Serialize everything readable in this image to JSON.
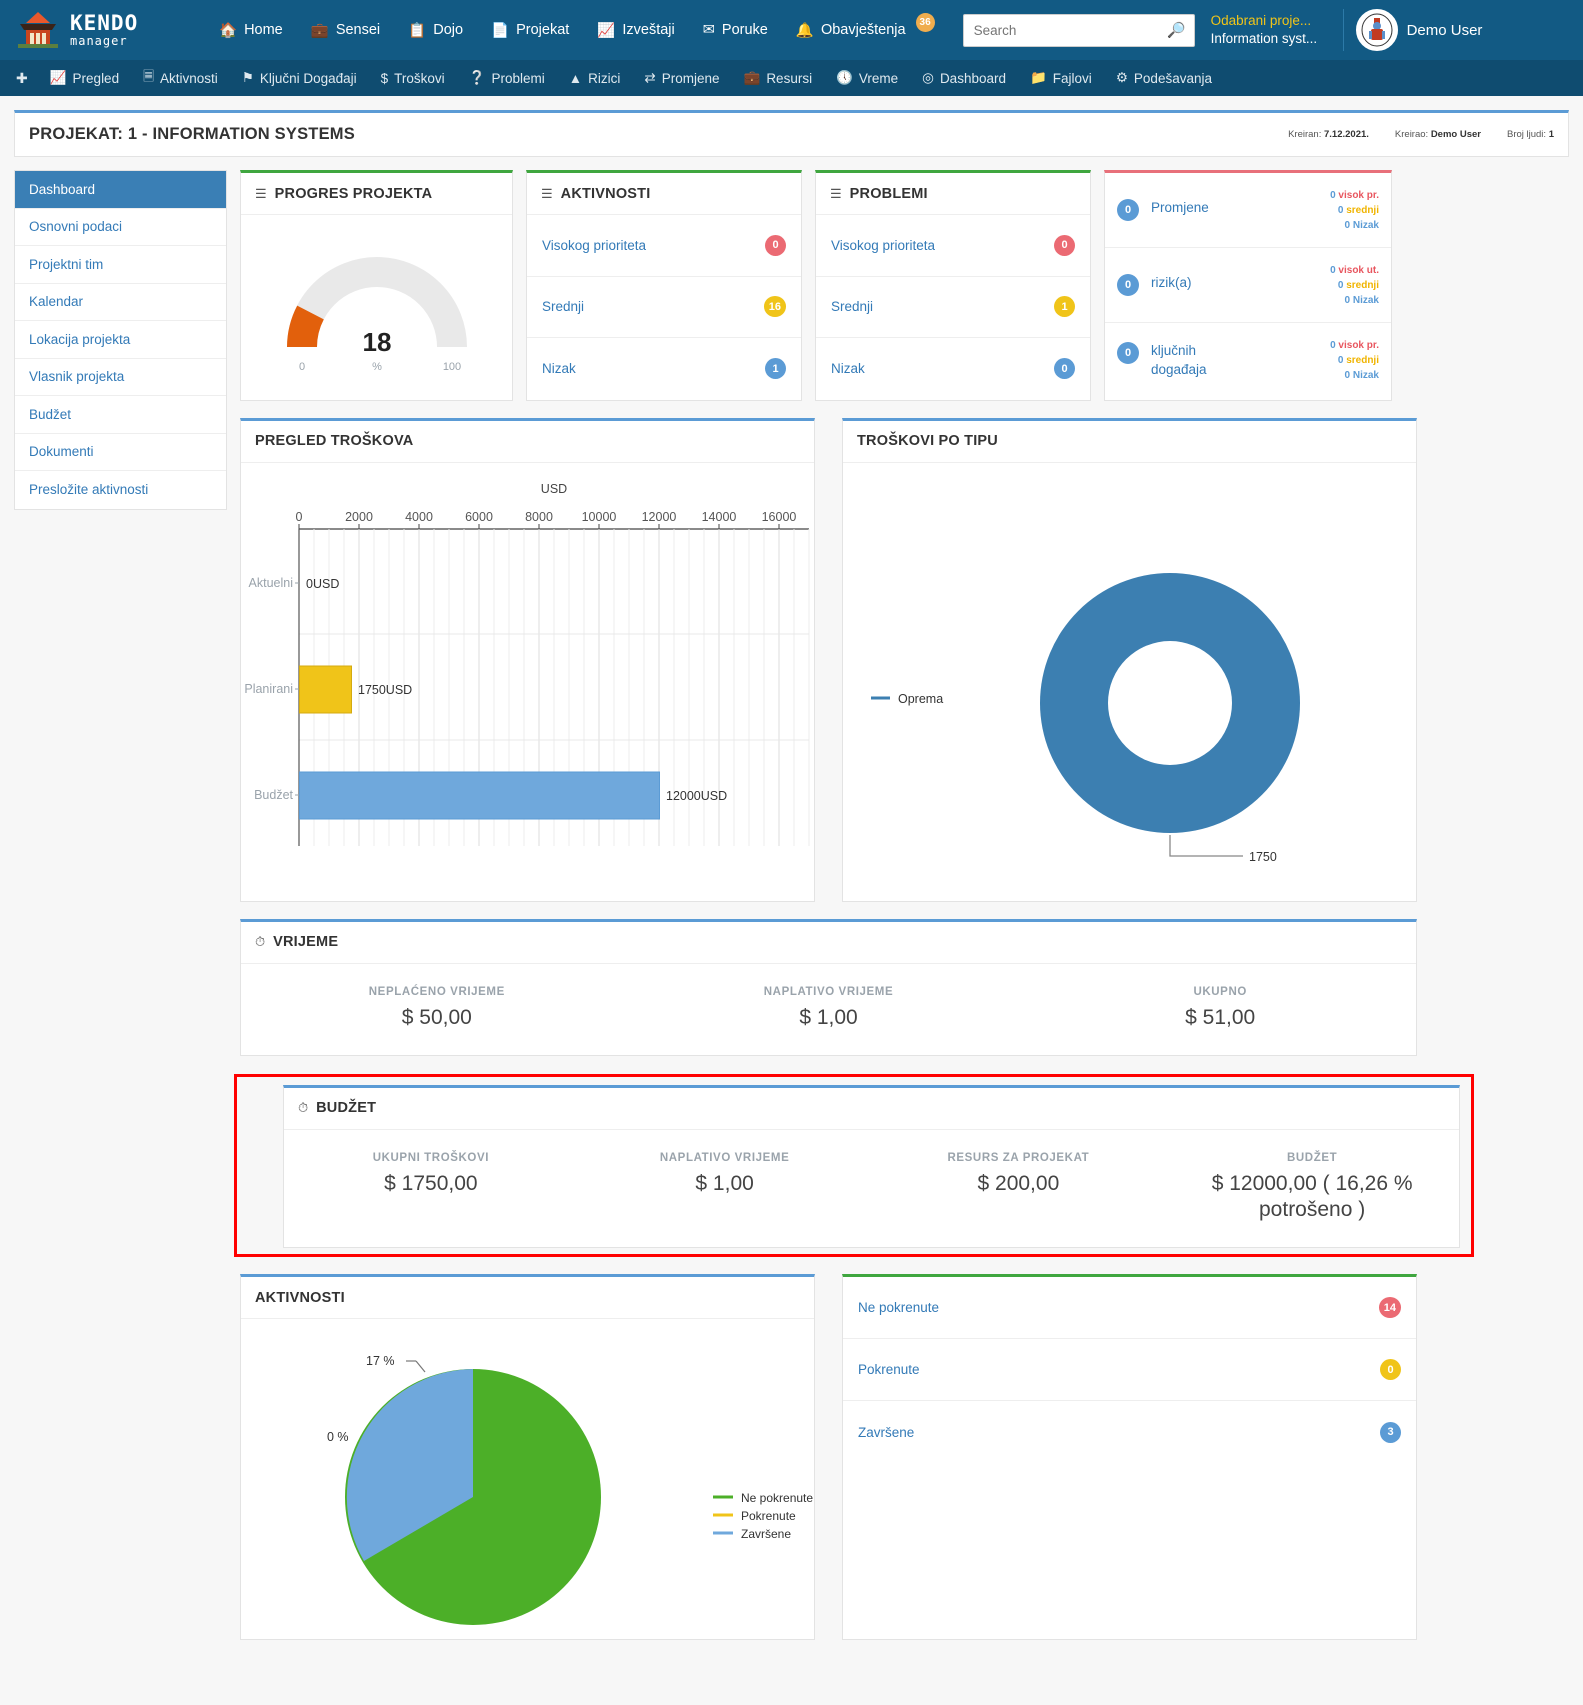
{
  "brand": {
    "name": "KENDO",
    "sub": "manager"
  },
  "topnav": [
    {
      "label": "Home",
      "icon": "home-icon"
    },
    {
      "label": "Sensei",
      "icon": "briefcase-icon"
    },
    {
      "label": "Dojo",
      "icon": "copy-icon"
    },
    {
      "label": "Projekat",
      "icon": "file-icon"
    },
    {
      "label": "Izveštaji",
      "icon": "chart-line-icon"
    },
    {
      "label": "Poruke",
      "icon": "envelope-icon"
    },
    {
      "label": "Obavještenja",
      "icon": "bell-icon",
      "badge": "36"
    }
  ],
  "search": {
    "placeholder": "Search",
    "value": ""
  },
  "project_selector": {
    "line1": "Odabrani proje...",
    "line2": "Information syst..."
  },
  "user": {
    "name": "Demo User"
  },
  "subnav": [
    {
      "label": "Pregled",
      "icon": "chart-line-icon"
    },
    {
      "label": "Aktivnosti",
      "icon": "file-lines-icon"
    },
    {
      "label": "Ključni Događaji",
      "icon": "flag-icon"
    },
    {
      "label": "Troškovi",
      "icon": "dollar-icon"
    },
    {
      "label": "Problemi",
      "icon": "question-circle-icon"
    },
    {
      "label": "Rizici",
      "icon": "warning-triangle-icon"
    },
    {
      "label": "Promjene",
      "icon": "exchange-icon"
    },
    {
      "label": "Resursi",
      "icon": "briefcase-icon"
    },
    {
      "label": "Vreme",
      "icon": "clock-icon"
    },
    {
      "label": "Dashboard",
      "icon": "dashboard-icon"
    },
    {
      "label": "Fajlovi",
      "icon": "folder-icon"
    },
    {
      "label": "Podešavanja",
      "icon": "gear-icon"
    }
  ],
  "page_title": "PROJEKAT: 1 - INFORMATION SYSTEMS",
  "page_meta": {
    "created_label": "Kreiran:",
    "created_value": "7.12.2021.",
    "author_label": "Kreirao:",
    "author_value": "Demo User",
    "people_label": "Broj ljudi:",
    "people_value": "1"
  },
  "sidebar": {
    "items": [
      {
        "label": "Dashboard",
        "active": true
      },
      {
        "label": "Osnovni podaci",
        "active": false
      },
      {
        "label": "Projektni tim",
        "active": false
      },
      {
        "label": "Kalendar",
        "active": false
      },
      {
        "label": "Lokacija projekta",
        "active": false
      },
      {
        "label": "Vlasnik projekta",
        "active": false
      },
      {
        "label": "Budžet",
        "active": false
      },
      {
        "label": "Dokumenti",
        "active": false
      },
      {
        "label": "Presložite aktivnosti",
        "active": false
      }
    ]
  },
  "progress_card": {
    "title": "PROGRES PROJEKTA",
    "value": "18",
    "min": "0",
    "max": "100",
    "unit": "%"
  },
  "aktivnosti_card": {
    "title": "AKTIVNOSTI",
    "rows": [
      {
        "label": "Visokog prioriteta",
        "count": "0",
        "color": "red"
      },
      {
        "label": "Srednji",
        "count": "16",
        "color": "yellow"
      },
      {
        "label": "Nizak",
        "count": "1",
        "color": "blue"
      }
    ]
  },
  "problemi_card": {
    "title": "PROBLEMI",
    "rows": [
      {
        "label": "Visokog prioriteta",
        "count": "0",
        "color": "red"
      },
      {
        "label": "Srednji",
        "count": "1",
        "color": "yellow"
      },
      {
        "label": "Nizak",
        "count": "0",
        "color": "blue"
      }
    ]
  },
  "summary_card": {
    "rows": [
      {
        "count": "0",
        "label": "Promjene",
        "breakdown": [
          {
            "n": "0",
            "text": "visok pr.",
            "level": "high"
          },
          {
            "n": "0",
            "text": "srednji",
            "level": "mid"
          },
          {
            "n": "0",
            "text": "Nizak",
            "level": "low"
          }
        ]
      },
      {
        "count": "0",
        "label": "rizik(a)",
        "breakdown": [
          {
            "n": "0",
            "text": "visok ut.",
            "level": "high"
          },
          {
            "n": "0",
            "text": "srednji",
            "level": "mid"
          },
          {
            "n": "0",
            "text": "Nizak",
            "level": "low"
          }
        ]
      },
      {
        "count": "0",
        "label": "ključnih događaja",
        "breakdown": [
          {
            "n": "0",
            "text": "visok pr.",
            "level": "high"
          },
          {
            "n": "0",
            "text": "srednji",
            "level": "mid"
          },
          {
            "n": "0",
            "text": "Nizak",
            "level": "low"
          }
        ]
      }
    ]
  },
  "vrijeme_card": {
    "title": "VRIJEME",
    "stats": [
      {
        "label": "NEPLAĆENO VRIJEME",
        "value": "$ 50,00"
      },
      {
        "label": "NAPLATIVO VRIJEME",
        "value": "$ 1,00"
      },
      {
        "label": "UKUPNO",
        "value": "$ 51,00"
      }
    ]
  },
  "budzet_card": {
    "title": "BUDŽET",
    "stats": [
      {
        "label": "UKUPNI TROŠKOVI",
        "value": "$ 1750,00"
      },
      {
        "label": "NAPLATIVO VRIJEME",
        "value": "$ 1,00"
      },
      {
        "label": "RESURS ZA PROJEKAT",
        "value": "$ 200,00"
      },
      {
        "label": "BUDŽET",
        "value": "$ 12000,00 ( 16,26 % potrošeno )"
      }
    ]
  },
  "aktivnosti_status": {
    "rows": [
      {
        "label": "Ne pokrenute",
        "count": "14",
        "color": "red"
      },
      {
        "label": "Pokrenute",
        "count": "0",
        "color": "yellow"
      },
      {
        "label": "Završene",
        "count": "3",
        "color": "blue"
      }
    ]
  },
  "chart_data": [
    {
      "type": "bar",
      "orientation": "horizontal",
      "title": "PREGLED TROŠKOVA",
      "xlabel": "USD",
      "ylabel": "",
      "categories": [
        "Aktuelni",
        "Planirani",
        "Budžet"
      ],
      "values": [
        0,
        1750,
        12000
      ],
      "data_labels": [
        "0USD",
        "1750USD",
        "12000USD"
      ],
      "colors": [
        "#3fa63f",
        "#f0c419",
        "#6fa8dc"
      ],
      "xticks": [
        0,
        2000,
        4000,
        6000,
        8000,
        10000,
        12000,
        14000,
        16000
      ],
      "xlim": [
        0,
        17000
      ],
      "grid": true
    },
    {
      "type": "pie",
      "variant": "donut",
      "title": "TROŠKOVI PO TIPU",
      "labels": [
        "Oprema"
      ],
      "values": [
        1750
      ],
      "data_labels": [
        "1750"
      ],
      "colors": [
        "#3c7fb1"
      ],
      "legend": [
        "Oprema"
      ],
      "legend_position": "left"
    },
    {
      "type": "pie",
      "title": "AKTIVNOSTI",
      "labels": [
        "Ne pokrenute",
        "Pokrenute",
        "Završene"
      ],
      "values": [
        83,
        0,
        17
      ],
      "data_labels": [
        "0 %",
        "17 %"
      ],
      "colors": [
        "#4caf28",
        "#f0c419",
        "#6fa8dc"
      ],
      "legend": [
        "Ne pokrenute",
        "Pokrenute",
        "Završene"
      ],
      "legend_position": "right"
    }
  ]
}
